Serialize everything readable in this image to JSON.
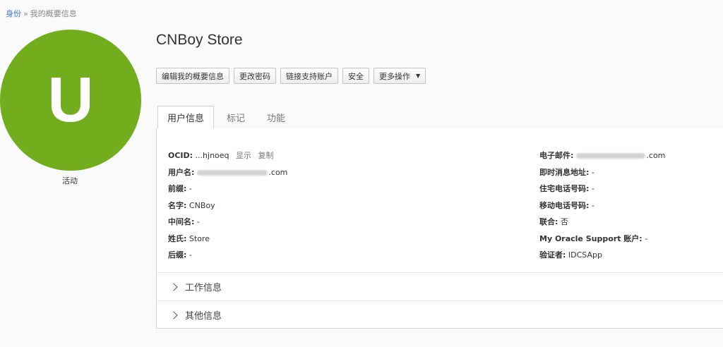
{
  "breadcrumb": {
    "root": "身份",
    "separator": "»",
    "current": "我的概要信息"
  },
  "avatar": {
    "letter": "U",
    "color": "#72ad1e"
  },
  "status": "活动",
  "title": "CNBoy Store",
  "actions": {
    "edit_profile": "编辑我的概要信息",
    "change_password": "更改密码",
    "link_support": "链接支持账户",
    "security": "安全",
    "more_actions": "更多操作"
  },
  "tabs": {
    "user_info": "用户信息",
    "tags": "标记",
    "features": "功能"
  },
  "user_info": {
    "ocid_label": "OCID:",
    "ocid_value": "...hjnoeq",
    "ocid_show": "显示",
    "ocid_copy": "复制",
    "username_label": "用户名:",
    "username_suffix": ".com",
    "prefix_label": "前缀:",
    "prefix_value": "-",
    "first_name_label": "名字:",
    "first_name_value": "CNBoy",
    "middle_name_label": "中间名:",
    "middle_name_value": "-",
    "last_name_label": "姓氏:",
    "last_name_value": "Store",
    "suffix_label": "后缀:",
    "suffix_value": "-",
    "email_label": "电子邮件:",
    "email_suffix": ".com",
    "im_label": "即时消息地址:",
    "im_value": "-",
    "home_phone_label": "住宅电话号码:",
    "home_phone_value": "-",
    "mobile_label": "移动电话号码:",
    "mobile_value": "-",
    "federated_label": "联合:",
    "federated_value": "否",
    "mos_label": "My Oracle Support 账户:",
    "mos_value": "-",
    "verifier_label": "验证者:",
    "verifier_value": "IDCSApp"
  },
  "sections": {
    "work_info": "工作信息",
    "other_info": "其他信息"
  }
}
